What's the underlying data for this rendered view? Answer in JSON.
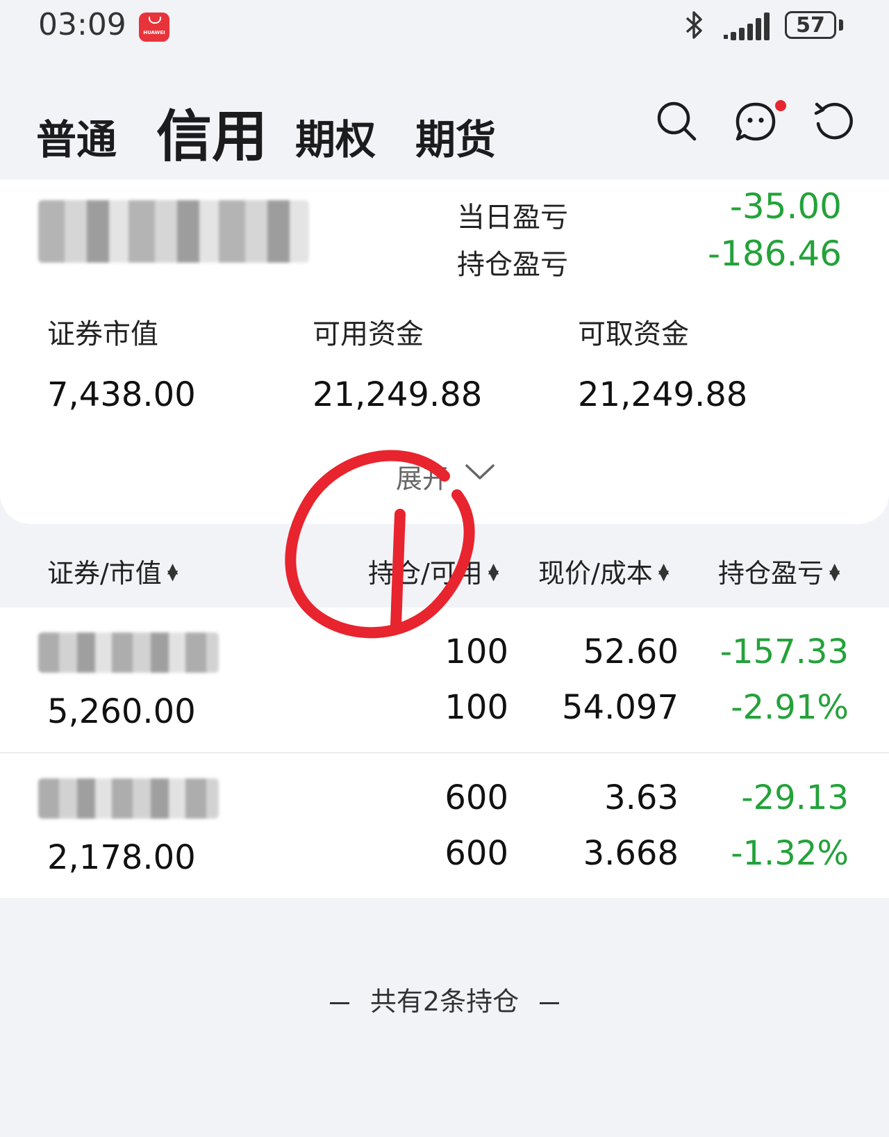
{
  "status_bar": {
    "time": "03:09",
    "app_badge_text": "HUAWEI",
    "battery": "57"
  },
  "tabs": [
    {
      "label": "普通"
    },
    {
      "label": "信用"
    },
    {
      "label": "期权"
    },
    {
      "label": "期货"
    }
  ],
  "active_tab": "信用",
  "header_icons": [
    "search-icon",
    "message-icon",
    "refresh-icon"
  ],
  "summary": {
    "daily_pl_label": "当日盈亏",
    "daily_pl_value": "-35.00",
    "position_pl_label": "持仓盈亏",
    "position_pl_value": "-186.46",
    "securities_value_label": "证券市值",
    "securities_value": "7,438.00",
    "available_funds_label": "可用资金",
    "available_funds": "21,249.88",
    "withdrawable_funds_label": "可取资金",
    "withdrawable_funds": "21,249.88",
    "expand_label": "展开"
  },
  "columns": {
    "security": "证券/市值",
    "holding": "持仓/可用",
    "price": "现价/成本",
    "pl": "持仓盈亏"
  },
  "holdings": [
    {
      "market_value": "5,260.00",
      "position": "100",
      "available": "100",
      "price": "52.60",
      "cost": "54.097",
      "pl": "-157.33",
      "pl_pct": "-2.91%"
    },
    {
      "market_value": "2,178.00",
      "position": "600",
      "available": "600",
      "price": "3.63",
      "cost": "3.668",
      "pl": "-29.13",
      "pl_pct": "-1.32%"
    }
  ],
  "footer": "共有2条持仓",
  "colors": {
    "loss_green": "#23a23a",
    "annotation_red": "#e8242e",
    "badge_red": "#e8333a"
  }
}
